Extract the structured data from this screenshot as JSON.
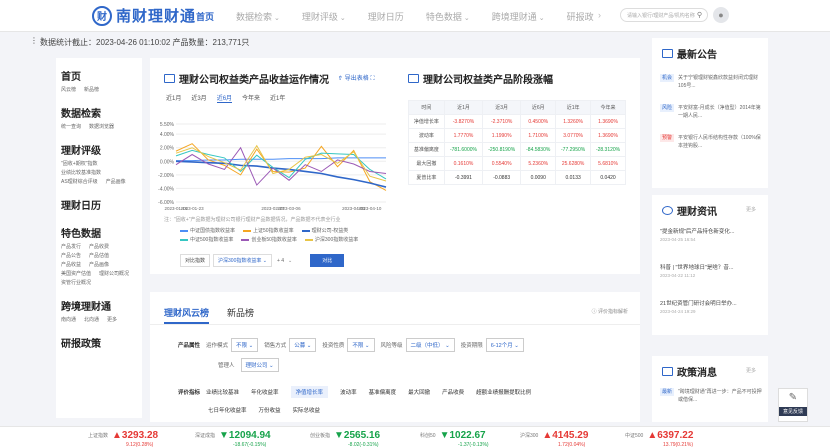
{
  "header": {
    "logo_mark": "财",
    "logo_text": "南财理财通",
    "nav": [
      {
        "label": "首页",
        "active": true,
        "has_menu": false
      },
      {
        "label": "数据检索",
        "active": false,
        "has_menu": true
      },
      {
        "label": "理财评级",
        "active": false,
        "has_menu": true
      },
      {
        "label": "理财日历",
        "active": false,
        "has_menu": false
      },
      {
        "label": "特色数据",
        "active": false,
        "has_menu": true
      },
      {
        "label": "跨境理财通",
        "active": false,
        "has_menu": true
      },
      {
        "label": "研报政",
        "active": false,
        "has_menu": false
      }
    ],
    "search_placeholder": "请输入银行/理财产品/机构名称",
    "arrow": "›"
  },
  "stat": {
    "text": "数据统计截止：2023-04-26 01:10:02  产品数量：213,771只"
  },
  "sidebar": [
    {
      "title": "首页",
      "items": [
        "风云榜",
        "新品榜"
      ]
    },
    {
      "title": "数据检索",
      "items": [
        "统一查询",
        "数据浏览器"
      ]
    },
    {
      "title": "理财评级",
      "items": [
        "\"固收+期权\"指数",
        "业绩比较基准指数",
        "AS理财综合评级",
        "产品画像"
      ]
    },
    {
      "title": "理财日历",
      "items": []
    },
    {
      "title": "特色数据",
      "items": [
        "产品发行",
        "产品收费",
        "产品公告",
        "产品估值",
        "产品收益",
        "产品画像",
        "美国资产估值",
        "理财公司概况",
        "资管行业概况"
      ]
    },
    {
      "title": "跨境理财通",
      "items": [
        "南向通",
        "北向通",
        "更多"
      ]
    },
    {
      "title": "研报政策",
      "items": []
    }
  ],
  "card1": {
    "title": "理财公司权益类产品收益运作情况",
    "export": "导出表格",
    "tabs": [
      "近1月",
      "近3月",
      "近6月",
      "今年来",
      "近1年"
    ],
    "selected_tab": 2,
    "note": "注：\"固收+\"产品数据为理财公司银行理财产品数据情况，产品数据不代表全行业",
    "legend": [
      {
        "name": "中证国债指数收益率",
        "color": "#4d8ef5"
      },
      {
        "name": "上证50指数收益率",
        "color": "#f5a623"
      },
      {
        "name": "理财公司-权益类",
        "color": "#2f67c9"
      },
      {
        "name": "中证500指数收益率",
        "color": "#36c6c2"
      },
      {
        "name": "创业板50指数收益率",
        "color": "#9b59b6"
      },
      {
        "name": "沪深300指数收益率",
        "color": "#e8c547"
      }
    ],
    "controls": {
      "compare_label": "对比指数",
      "select_value": "沪深300指数收益率",
      "plus": "+ 4",
      "confirm": "对比"
    }
  },
  "card1_table": {
    "title": "理财公司权益类产品阶段涨幅",
    "headers": [
      "时间",
      "近1月",
      "近3月",
      "近6月",
      "近1年",
      "今年来"
    ],
    "rows": [
      {
        "label": "净值增长率",
        "cells": [
          "-3.8270%",
          "-2.3710%",
          "0.4500%",
          "1.3260%",
          "1.3690%"
        ],
        "cls": [
          "red",
          "red",
          "red",
          "red",
          "red"
        ]
      },
      {
        "label": "波动率",
        "cells": [
          "1.7770%",
          "1.1990%",
          "1.7100%",
          "3.0770%",
          "1.3690%"
        ],
        "cls": [
          "red",
          "red",
          "red",
          "red",
          "red"
        ]
      },
      {
        "label": "基准偏离度",
        "cells": [
          "-781.6000%",
          "-250.8190%",
          "-84.5830%",
          "-77.2950%",
          "-28.3120%"
        ],
        "cls": [
          "grn",
          "grn",
          "grn",
          "grn",
          "grn"
        ]
      },
      {
        "label": "最大回撤",
        "cells": [
          "0.1610%",
          "0.5540%",
          "5.2360%",
          "25.6280%",
          "5.6810%"
        ],
        "cls": [
          "red",
          "red",
          "red",
          "red",
          "red"
        ]
      },
      {
        "label": "夏普比率",
        "cells": [
          "-0.3991",
          "-0.0883",
          "0.0090",
          "0.0133",
          "0.0420"
        ],
        "cls": [
          "",
          "",
          "",
          "",
          ""
        ]
      }
    ]
  },
  "chart_data": {
    "type": "line",
    "x": [
      "2023-01-16",
      "2023-01-23",
      "2023-01-30",
      "2023-02-06",
      "2023-02-13",
      "2023-02-20",
      "2023-02-27",
      "2023-03-06",
      "2023-03-13",
      "2023-03-20",
      "2023-03-27",
      "2023-04-03",
      "2023-04-10",
      "2023-04-17"
    ],
    "x_tick_labels": [
      "2023-01-16",
      "2023-01-23",
      "2023-02-27",
      "2023-03-06",
      "2023-04-03",
      "2023-04-10"
    ],
    "yticks": [
      "5.50%",
      "4.00%",
      "2.00%",
      "0.00%",
      "-2.00%",
      "-4.00%",
      "-6.00%"
    ],
    "ylim": [
      -6,
      5.5
    ],
    "series": [
      {
        "name": "中证国债指数收益率",
        "color": "#4d8ef5",
        "values": [
          0.1,
          0.1,
          0.2,
          0.2,
          0.3,
          0.3,
          0.3,
          0.4,
          0.4,
          0.4,
          0.5,
          0.5,
          0.5,
          0.5
        ]
      },
      {
        "name": "上证50指数收益率",
        "color": "#f5a623",
        "values": [
          1.5,
          2.6,
          0.2,
          -0.6,
          -2.0,
          1.8,
          -1.5,
          -1.6,
          -1.0,
          2.2,
          -0.8,
          1.6,
          -3.0,
          -4.3
        ]
      },
      {
        "name": "理财公司-权益类",
        "color": "#2f67c9",
        "values": [
          0.0,
          -0.1,
          -0.2,
          -0.3,
          -0.6,
          -0.7,
          -1.0,
          -1.2,
          -1.5,
          -1.8,
          -2.3,
          -2.7,
          -3.2,
          -3.8
        ]
      },
      {
        "name": "中证500指数收益率",
        "color": "#36c6c2",
        "values": [
          0.8,
          1.6,
          1.0,
          0.5,
          -1.5,
          0.9,
          -0.9,
          -2.4,
          0.3,
          1.2,
          1.1,
          1.0,
          -1.2,
          -2.6
        ]
      },
      {
        "name": "创业板50指数收益率",
        "color": "#9b59b6",
        "values": [
          -0.5,
          1.0,
          -0.4,
          -1.2,
          2.0,
          -3.5,
          -1.0,
          -2.8,
          -0.5,
          -1.5,
          0.2,
          -0.4,
          -1.5,
          -1.8
        ]
      },
      {
        "name": "沪深300指数收益率",
        "color": "#e8c547",
        "values": [
          1.2,
          2.0,
          0.7,
          -0.2,
          -1.3,
          2.3,
          -1.8,
          -1.2,
          0.6,
          1.0,
          -0.3,
          1.4,
          -2.2,
          -2.9
        ]
      }
    ]
  },
  "card2": {
    "tab_active": "理财风云榜",
    "tab_other": "新品榜",
    "hint": "评价指标解析",
    "filters": {
      "label": "产品属性",
      "items": [
        {
          "name": "运作模式",
          "value": "不限"
        },
        {
          "name": "销售方式",
          "value": "公募"
        },
        {
          "name": "投资性质",
          "value": "不限"
        },
        {
          "name": "风险等级",
          "value": "二级（中低）"
        },
        {
          "name": "投资期限",
          "value": "6-12个月"
        }
      ],
      "manager_label": "管理人",
      "manager_value": "理财公司"
    },
    "metrics_label": "评价指标",
    "metrics": [
      "业绩比较基准",
      "年化收益率",
      "净值增长率",
      "波动率",
      "基准偏离度",
      "最大回撤",
      "产品收费",
      "超额业绩报酬提取比例"
    ],
    "metrics_selected": 2,
    "metrics2": [
      "七日年化收益率",
      "万份收益",
      "实际总收益"
    ]
  },
  "announcements": {
    "title": "最新公告",
    "items": [
      {
        "tag": "机会",
        "tag_cls": "t1",
        "text": "关于宁银理财锐鑫欣款益封闭式理财105号..."
      },
      {
        "tag": "风险",
        "tag_cls": "t1",
        "text": "平安财富-月成长（净值型）2014年第一期人民..."
      },
      {
        "tag": "预警",
        "tag_cls": "t2",
        "text": "平安银行人民币结构性存款（100%保本挂钩股..."
      }
    ]
  },
  "info": {
    "title": "理财资讯",
    "more": "更多",
    "items": [
      {
        "text": "\"提金新规\"后产品持仓新变化...",
        "date": "2023-04-25 16:54"
      },
      {
        "text": "科普 | \"世界地球日\"是啥？昔...",
        "date": "2023-04-22 11:12"
      },
      {
        "text": "21世纪资管门研讨会明日举办...",
        "date": "2023-04-24 19:29"
      }
    ]
  },
  "policy": {
    "title": "政策消息",
    "more": "更多",
    "item_tag": "最新",
    "item_text": "\"跨境理财通\"再进一步：产品不可投押或借保..."
  },
  "feedback": {
    "label": "意见反馈"
  },
  "indices": [
    {
      "name": "上证指数",
      "value": "▲3293.28",
      "change": "9.12(0.28%)",
      "dir": "up"
    },
    {
      "name": "深证成指",
      "value": "▼12094.94",
      "change": "-18.67(-0.15%)",
      "dir": "down"
    },
    {
      "name": "创业板指",
      "value": "▼2565.16",
      "change": "-8.02(-0.31%)",
      "dir": "down"
    },
    {
      "name": "科创50",
      "value": "▼1022.67",
      "change": "-1.37(-0.13%)",
      "dir": "down"
    },
    {
      "name": "沪深300",
      "value": "▲4145.29",
      "change": "1.72(0.04%)",
      "dir": "up"
    },
    {
      "name": "中证500",
      "value": "▲6397.22",
      "change": "13.79(0.21%)",
      "dir": "up"
    }
  ]
}
